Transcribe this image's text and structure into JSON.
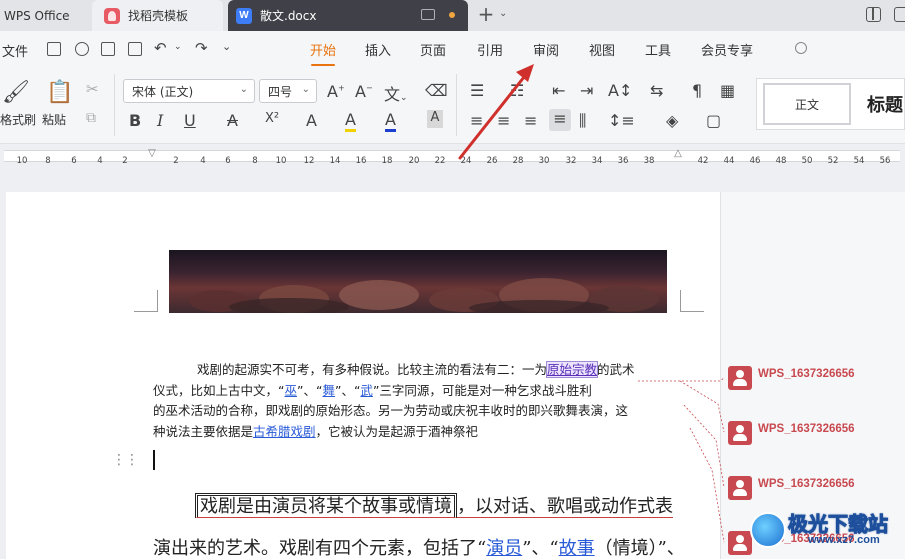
{
  "tabs": [
    {
      "label": "WPS Office"
    },
    {
      "label": "找稻壳模板"
    },
    {
      "label": "散文.docx",
      "icon_letter": "W"
    }
  ],
  "menu": {
    "file": "文件",
    "items": [
      "开始",
      "插入",
      "页面",
      "引用",
      "审阅",
      "视图",
      "工具",
      "会员专享"
    ],
    "active": "开始"
  },
  "ribbon": {
    "format_painter": "格式刷",
    "paste": "粘贴",
    "font_name": "宋体 (正文)",
    "font_size": "四号",
    "styles": {
      "normal": "正文",
      "heading": "标题"
    },
    "format_glyphs": [
      "B",
      "I",
      "U",
      "A",
      "X²",
      "A",
      "A",
      "A",
      "A"
    ]
  },
  "ruler": {
    "labels": [
      "10",
      "8",
      "6",
      "4",
      "2",
      "2",
      "2",
      "4",
      "6",
      "8",
      "10",
      "12",
      "14",
      "16",
      "18",
      "20",
      "22",
      "24",
      "26",
      "28",
      "30",
      "32",
      "34",
      "36",
      "38",
      "42",
      "44",
      "46",
      "48",
      "50",
      "52",
      "54",
      "56"
    ]
  },
  "document": {
    "para1": {
      "l1_a": "戏剧的起源实不可考，有多种假说。比较主流的看法有二：一为",
      "l1_link": "原始宗教",
      "l1_b": "的武术",
      "l2_a": "仪式，比如上古中文，“",
      "l2_w1": "巫",
      "l2_b": "”、“",
      "l2_w2": "舞",
      "l2_c": "”、“",
      "l2_w3": "武",
      "l2_d": "”三字同源，可能是对一种乞求战斗胜利",
      "l3": "的巫术活动的合称，即戏剧的原始形态。另一为劳动或庆祝丰收时的即兴歌舞表演，这",
      "l4_a": "种说法主要依据是",
      "l4_link": "古希腊戏剧",
      "l4_b": "，它被认为是起源于酒神祭祀"
    },
    "para2": {
      "boxed": "戏剧是由演员将某个故事或情境",
      "l1_rest": "，以对话、歌唱或动作式表",
      "l2_a": "演出来的艺术。",
      "l2_b": "戏剧有四个元素，包括了“",
      "l2_link1": "演员",
      "l2_c": "”、“",
      "l2_link2": "故事",
      "l2_d": "（情境）”、"
    }
  },
  "comments": [
    {
      "author": "WPS_1637326656"
    },
    {
      "author": "WPS_1637326656"
    },
    {
      "author": "WPS_1637326656"
    },
    {
      "author": "WPS_1637326656"
    }
  ],
  "watermark": {
    "text": "极光下载站",
    "url": "www.xz7.com"
  },
  "colors": {
    "accent": "#e8730f",
    "comment": "#c8494f",
    "link": "#2a5bd7",
    "arrow": "#d0302c"
  }
}
